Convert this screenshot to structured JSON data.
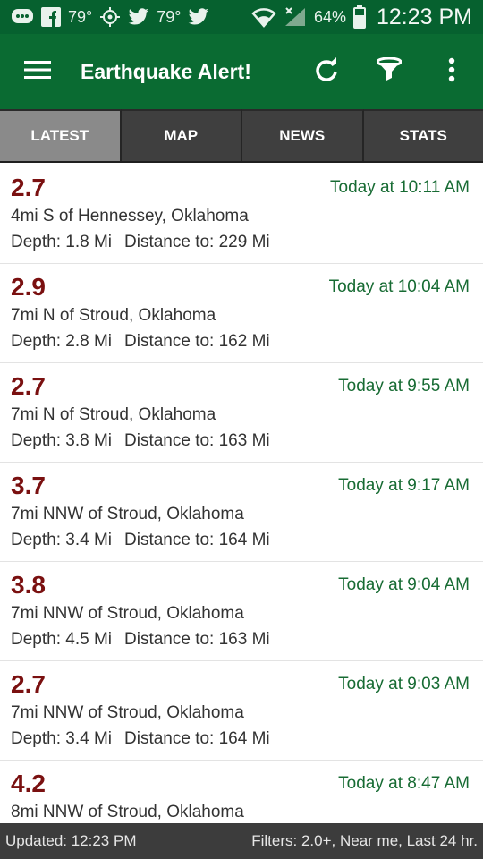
{
  "status_bar": {
    "temp1": "79°",
    "temp2": "79°",
    "battery": "64%",
    "clock": "12:23 PM",
    "icons": [
      "chat-icon",
      "facebook-icon",
      "location-target-icon",
      "twitter-icon",
      "twitter-icon",
      "wifi-icon",
      "signal-icon",
      "battery-icon"
    ]
  },
  "appbar": {
    "title": "Earthquake Alert!",
    "color": "#0a6b32",
    "icons": [
      "menu-icon",
      "refresh-icon",
      "filter-icon",
      "more-vert-icon"
    ]
  },
  "tabs": [
    {
      "label": "LATEST",
      "active": true
    },
    {
      "label": "MAP",
      "active": false
    },
    {
      "label": "NEWS",
      "active": false
    },
    {
      "label": "STATS",
      "active": false
    }
  ],
  "quakes": [
    {
      "mag": "2.7",
      "time": "Today at 10:11 AM",
      "location": "4mi S of Hennessey, Oklahoma",
      "depth": "Depth: 1.8 Mi",
      "distance": "Distance to: 229 Mi"
    },
    {
      "mag": "2.9",
      "time": "Today at 10:04 AM",
      "location": "7mi N of Stroud, Oklahoma",
      "depth": "Depth: 2.8 Mi",
      "distance": "Distance to: 162 Mi"
    },
    {
      "mag": "2.7",
      "time": "Today at 9:55 AM",
      "location": "7mi N of Stroud, Oklahoma",
      "depth": "Depth: 3.8 Mi",
      "distance": "Distance to: 163 Mi"
    },
    {
      "mag": "3.7",
      "time": "Today at 9:17 AM",
      "location": "7mi NNW of Stroud, Oklahoma",
      "depth": "Depth: 3.4 Mi",
      "distance": "Distance to: 164 Mi"
    },
    {
      "mag": "3.8",
      "time": "Today at 9:04 AM",
      "location": "7mi NNW of Stroud, Oklahoma",
      "depth": "Depth: 4.5 Mi",
      "distance": "Distance to: 163 Mi"
    },
    {
      "mag": "2.7",
      "time": "Today at 9:03 AM",
      "location": "7mi NNW of Stroud, Oklahoma",
      "depth": "Depth: 3.4 Mi",
      "distance": "Distance to: 164 Mi"
    },
    {
      "mag": "4.2",
      "time": "Today at 8:47 AM",
      "location": "8mi NNW of Stroud, Oklahoma",
      "depth": "",
      "distance": ""
    }
  ],
  "footer": {
    "updated": "Updated: 12:23 PM",
    "filters": "Filters: 2.0+, Near me, Last 24 hr."
  },
  "colors": {
    "magnitude": "#7a1010",
    "time": "#176b33",
    "appbar": "#0a6b32",
    "statusbar": "#06612f"
  }
}
